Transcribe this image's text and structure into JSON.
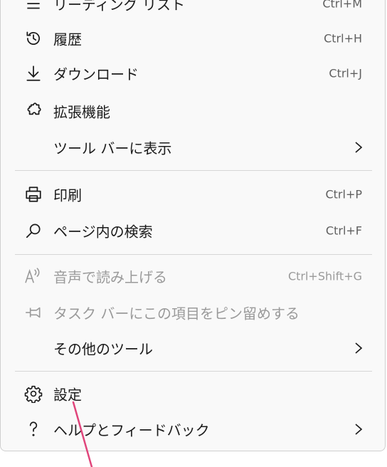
{
  "menu": {
    "items": [
      {
        "label": "リーディング リスト",
        "shortcut": "Ctrl+M",
        "icon": "reading-list-icon",
        "state": "enabled"
      },
      {
        "label": "履歴",
        "shortcut": "Ctrl+H",
        "icon": "history-icon",
        "state": "enabled"
      },
      {
        "label": "ダウンロード",
        "shortcut": "Ctrl+J",
        "icon": "download-icon",
        "state": "enabled"
      },
      {
        "label": "拡張機能",
        "shortcut": "",
        "icon": "extensions-icon",
        "state": "enabled"
      },
      {
        "label": "ツール バーに表示",
        "shortcut": "",
        "icon": "chevron-right-icon",
        "state": "submenu"
      },
      {
        "label": "印刷",
        "shortcut": "Ctrl+P",
        "icon": "print-icon",
        "state": "enabled"
      },
      {
        "label": "ページ内の検索",
        "shortcut": "Ctrl+F",
        "icon": "search-icon",
        "state": "enabled"
      },
      {
        "label": "音声で読み上げる",
        "shortcut": "Ctrl+Shift+G",
        "icon": "read-aloud-icon",
        "state": "disabled"
      },
      {
        "label": "タスク バーにこの項目をピン留めする",
        "shortcut": "",
        "icon": "pin-icon",
        "state": "disabled"
      },
      {
        "label": "その他のツール",
        "shortcut": "",
        "icon": "chevron-right-icon",
        "state": "submenu"
      },
      {
        "label": "設定",
        "shortcut": "",
        "icon": "gear-icon",
        "state": "enabled"
      },
      {
        "label": "ヘルプとフィードバック",
        "shortcut": "",
        "icon": "help-icon",
        "state": "submenu"
      }
    ]
  },
  "colors": {
    "menu_bg": "#f9f9f9",
    "text": "#1b1b1b",
    "shortcut_text": "#5f5f5f",
    "disabled_text": "#9a9a9a",
    "separator": "#d6d6d6",
    "annotation_line": "#e0457b"
  }
}
